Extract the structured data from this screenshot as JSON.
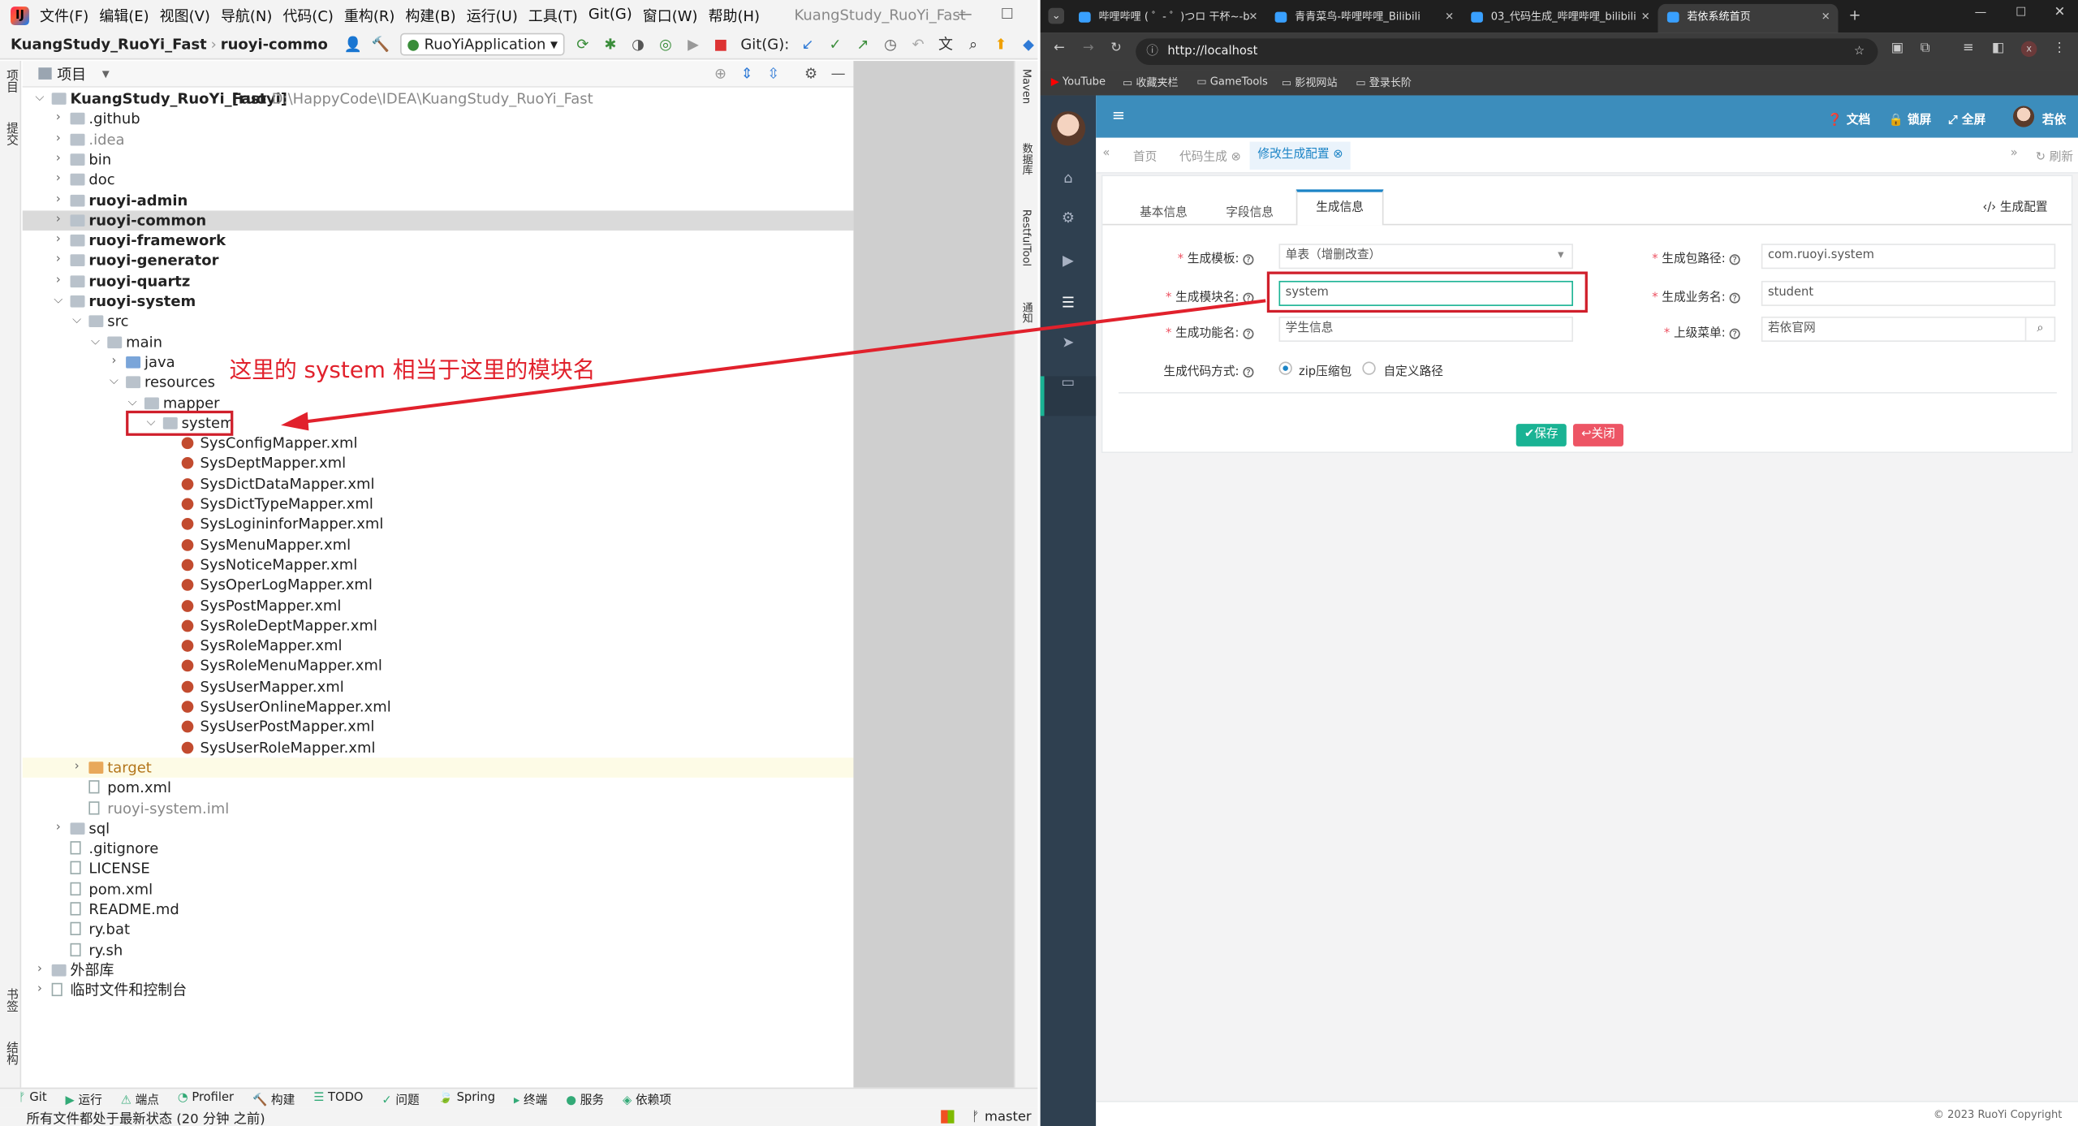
{
  "ide": {
    "menus": [
      "文件(F)",
      "编辑(E)",
      "视图(V)",
      "导航(N)",
      "代码(C)",
      "重构(R)",
      "构建(B)",
      "运行(U)",
      "工具(T)",
      "Git(G)",
      "窗口(W)",
      "帮助(H)"
    ],
    "window_title": "KuangStudy_RuoYi_Fast",
    "breadcrumb": [
      "KuangStudy_RuoYi_Fast",
      "ruoyi-commo"
    ],
    "run_config": "RuoYiApplication",
    "git_label": "Git(G):",
    "project_label": "项目",
    "strip_left": [
      "项目",
      "提交",
      "书签",
      "结构"
    ],
    "strip_right": [
      "Maven",
      "数据库",
      "RestfulTool",
      "通知"
    ],
    "tree": [
      {
        "indent": 0,
        "arrow": "v",
        "icon": "folder",
        "label": "KuangStudy_RuoYi_Fast",
        "suffix": "[ruoyi]",
        "path": "D:\\HappyCode\\IDEA\\KuangStudy_RuoYi_Fast",
        "bold": true
      },
      {
        "indent": 1,
        "arrow": ">",
        "icon": "folder",
        "label": ".github"
      },
      {
        "indent": 1,
        "arrow": ">",
        "icon": "folder",
        "label": ".idea",
        "grey": true
      },
      {
        "indent": 1,
        "arrow": ">",
        "icon": "folder",
        "label": "bin"
      },
      {
        "indent": 1,
        "arrow": ">",
        "icon": "folder",
        "label": "doc"
      },
      {
        "indent": 1,
        "arrow": ">",
        "icon": "folder",
        "label": "ruoyi-admin",
        "bold": true
      },
      {
        "indent": 1,
        "arrow": ">",
        "icon": "folder",
        "label": "ruoyi-common",
        "bold": true,
        "selected": true
      },
      {
        "indent": 1,
        "arrow": ">",
        "icon": "folder",
        "label": "ruoyi-framework",
        "bold": true
      },
      {
        "indent": 1,
        "arrow": ">",
        "icon": "folder",
        "label": "ruoyi-generator",
        "bold": true
      },
      {
        "indent": 1,
        "arrow": ">",
        "icon": "folder",
        "label": "ruoyi-quartz",
        "bold": true
      },
      {
        "indent": 1,
        "arrow": "v",
        "icon": "folder",
        "label": "ruoyi-system",
        "bold": true
      },
      {
        "indent": 2,
        "arrow": "v",
        "icon": "folder",
        "label": "src"
      },
      {
        "indent": 3,
        "arrow": "v",
        "icon": "folder",
        "label": "main"
      },
      {
        "indent": 4,
        "arrow": ">",
        "icon": "folder-blue",
        "label": "java"
      },
      {
        "indent": 4,
        "arrow": "v",
        "icon": "folder",
        "label": "resources"
      },
      {
        "indent": 5,
        "arrow": "v",
        "icon": "folder",
        "label": "mapper"
      },
      {
        "indent": 6,
        "arrow": "v",
        "icon": "folder",
        "label": "system"
      },
      {
        "indent": 7,
        "icon": "xml",
        "label": "SysConfigMapper.xml"
      },
      {
        "indent": 7,
        "icon": "xml",
        "label": "SysDeptMapper.xml"
      },
      {
        "indent": 7,
        "icon": "xml",
        "label": "SysDictDataMapper.xml"
      },
      {
        "indent": 7,
        "icon": "xml",
        "label": "SysDictTypeMapper.xml"
      },
      {
        "indent": 7,
        "icon": "xml",
        "label": "SysLogininforMapper.xml"
      },
      {
        "indent": 7,
        "icon": "xml",
        "label": "SysMenuMapper.xml"
      },
      {
        "indent": 7,
        "icon": "xml",
        "label": "SysNoticeMapper.xml"
      },
      {
        "indent": 7,
        "icon": "xml",
        "label": "SysOperLogMapper.xml"
      },
      {
        "indent": 7,
        "icon": "xml",
        "label": "SysPostMapper.xml"
      },
      {
        "indent": 7,
        "icon": "xml",
        "label": "SysRoleDeptMapper.xml"
      },
      {
        "indent": 7,
        "icon": "xml",
        "label": "SysRoleMapper.xml"
      },
      {
        "indent": 7,
        "icon": "xml",
        "label": "SysRoleMenuMapper.xml"
      },
      {
        "indent": 7,
        "icon": "xml",
        "label": "SysUserMapper.xml"
      },
      {
        "indent": 7,
        "icon": "xml",
        "label": "SysUserOnlineMapper.xml"
      },
      {
        "indent": 7,
        "icon": "xml",
        "label": "SysUserPostMapper.xml"
      },
      {
        "indent": 7,
        "icon": "xml",
        "label": "SysUserRoleMapper.xml"
      },
      {
        "indent": 2,
        "arrow": ">",
        "icon": "folder-orange",
        "label": "target",
        "orange": true,
        "highlight": true
      },
      {
        "indent": 2,
        "icon": "file",
        "label": "pom.xml"
      },
      {
        "indent": 2,
        "icon": "file",
        "label": "ruoyi-system.iml",
        "grey": true
      },
      {
        "indent": 1,
        "arrow": ">",
        "icon": "folder",
        "label": "sql"
      },
      {
        "indent": 1,
        "icon": "file",
        "label": ".gitignore"
      },
      {
        "indent": 1,
        "icon": "file",
        "label": "LICENSE"
      },
      {
        "indent": 1,
        "icon": "file",
        "label": "pom.xml"
      },
      {
        "indent": 1,
        "icon": "file",
        "label": "README.md"
      },
      {
        "indent": 1,
        "icon": "file",
        "label": "ry.bat"
      },
      {
        "indent": 1,
        "icon": "file",
        "label": "ry.sh"
      },
      {
        "indent": 0,
        "arrow": ">",
        "icon": "folder",
        "label": "外部库"
      },
      {
        "indent": 0,
        "arrow": ">",
        "icon": "file",
        "label": "临时文件和控制台"
      }
    ],
    "annotation": "这里的 system 相当于这里的模块名",
    "bottom_tools": [
      "Git",
      "运行",
      "端点",
      "Profiler",
      "构建",
      "TODO",
      "问题",
      "Spring",
      "终端",
      "服务",
      "依赖项"
    ],
    "status_text": "所有文件都处于最新状态 (20 分钟 之前)",
    "branch": "master"
  },
  "browser": {
    "tabs": [
      {
        "title": "哔哩哔哩 ( ゜- ゜)つロ 干杯~-b",
        "active": false
      },
      {
        "title": "青青菜鸟-哔哩哔哩_Bilibili",
        "active": false
      },
      {
        "title": "03_代码生成_哔哩哔哩_bilibili",
        "active": false
      },
      {
        "title": "若依系统首页",
        "active": true
      }
    ],
    "url": "http://localhost",
    "bookmarks": [
      "YouTube",
      "收藏夹栏",
      "GameTools",
      "影视网站",
      "登录长阶"
    ],
    "app": {
      "top_items": [
        "文档",
        "锁屏",
        "全屏",
        "若依"
      ],
      "tags": [
        "首页",
        "代码生成",
        "修改生成配置"
      ],
      "refresh": "刷新",
      "form_tabs": [
        "基本信息",
        "字段信息",
        "生成信息"
      ],
      "gen_config_link": "生成配置",
      "fields": {
        "template_label": "生成模板:",
        "template_value": "单表（增删改查）",
        "package_label": "生成包路径:",
        "package_value": "com.ruoyi.system",
        "module_label": "生成模块名:",
        "module_value": "system",
        "business_label": "生成业务名:",
        "business_value": "student",
        "function_label": "生成功能名:",
        "function_value": "学生信息",
        "parent_menu_label": "上级菜单:",
        "parent_menu_value": "若依官网",
        "gen_type_label": "生成代码方式:",
        "gen_type_zip": "zip压缩包",
        "gen_type_custom": "自定义路径"
      },
      "save_btn": "保存",
      "close_btn": "关闭",
      "footer": "© 2023 RuoYi Copyright"
    }
  }
}
